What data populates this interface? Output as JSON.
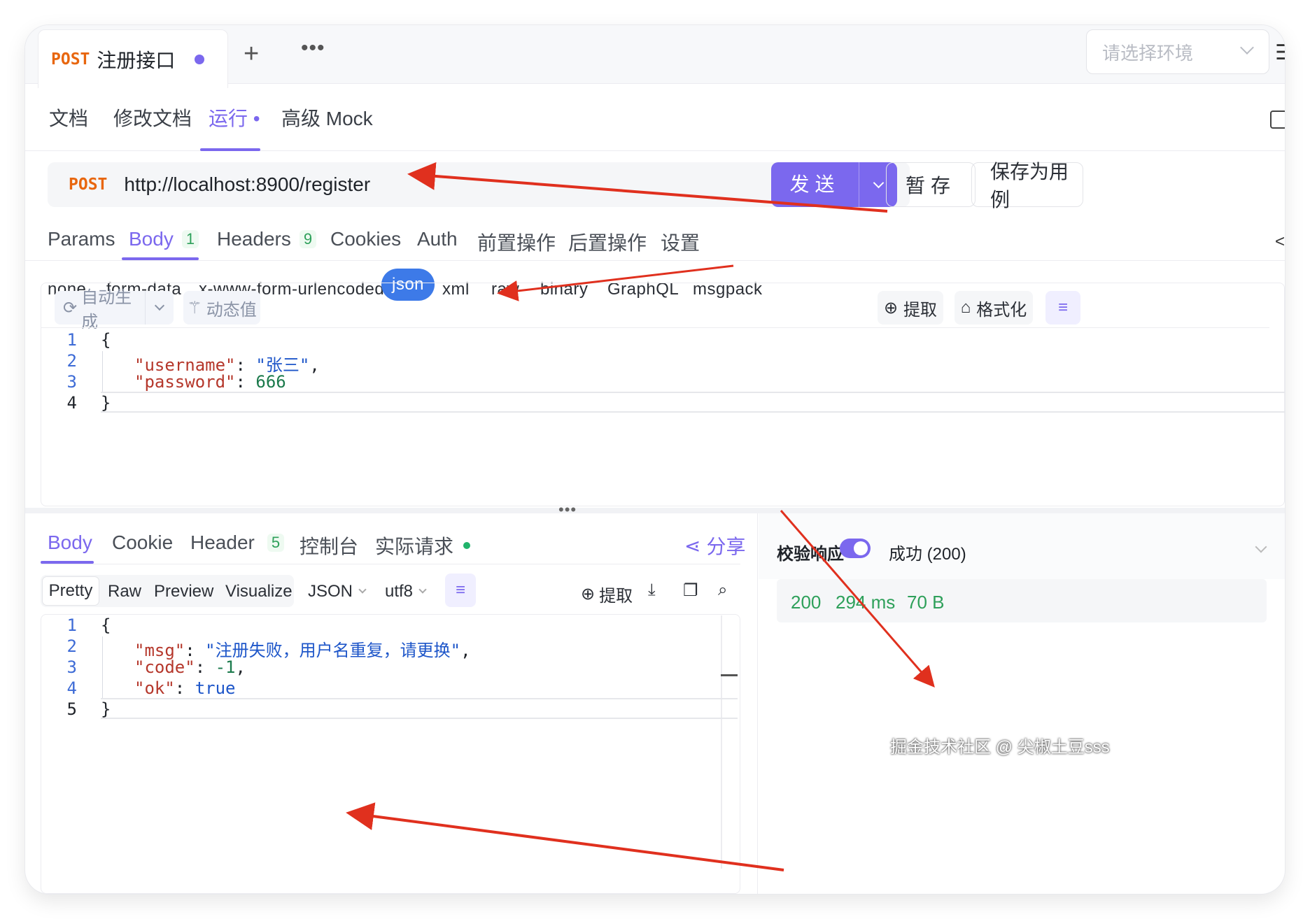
{
  "request_tab": {
    "method": "POST",
    "title": "注册接口"
  },
  "env_select": {
    "placeholder": "请选择环境"
  },
  "sub_tabs": [
    {
      "label": "文档"
    },
    {
      "label": "修改文档"
    },
    {
      "label": "运行 •"
    },
    {
      "label": "高级 Mock"
    }
  ],
  "url_bar": {
    "method": "POST",
    "url": "http://localhost:8900/register"
  },
  "actions": {
    "send": "发送",
    "stash": "暂存",
    "save_case": "保存为用例"
  },
  "request_tabs": [
    {
      "label": "Params"
    },
    {
      "label": "Body",
      "count": "1"
    },
    {
      "label": "Headers",
      "count": "9"
    },
    {
      "label": "Cookies"
    },
    {
      "label": "Auth"
    },
    {
      "label": "前置操作"
    },
    {
      "label": "后置操作"
    },
    {
      "label": "设置"
    }
  ],
  "body_types": [
    "none",
    "form-data",
    "x-www-form-urlencoded",
    "json",
    "xml",
    "raw",
    "binary",
    "GraphQL",
    "msgpack"
  ],
  "editor_toolbar": {
    "auto_generate": "自动生成",
    "dynamic_value": "动态值",
    "extract": "提取",
    "format": "格式化"
  },
  "request_body": {
    "line_numbers": [
      "1",
      "2",
      "3",
      "4"
    ],
    "open_brace": "{",
    "key1": "\"username\"",
    "val1": "\"张三\"",
    "key2": "\"password\"",
    "val2": "666",
    "close_brace": "}"
  },
  "response_tabs": [
    {
      "label": "Body"
    },
    {
      "label": "Cookie"
    },
    {
      "label": "Header",
      "count": "5"
    },
    {
      "label": "控制台"
    },
    {
      "label": "实际请求"
    }
  ],
  "share": "分享",
  "view_modes": [
    "Pretty",
    "Raw",
    "Preview",
    "Visualize"
  ],
  "format_select": "JSON",
  "encoding_select": "utf8",
  "response_extract": "提取",
  "response_body": {
    "line_numbers": [
      "1",
      "2",
      "3",
      "4",
      "5"
    ],
    "open_brace": "{",
    "key1": "\"msg\"",
    "val1": "\"注册失败，用户名重复，请更换\"",
    "key2": "\"code\"",
    "val2": "-1",
    "key3": "\"ok\"",
    "val3": "true",
    "close_brace": "}"
  },
  "validation": {
    "label": "校验响应",
    "enabled": true,
    "result": "成功 (200)"
  },
  "status": {
    "code": "200",
    "time": "294 ms",
    "size": "70 B"
  },
  "watermark": "掘金技术社区 @ 尖椒土豆sss",
  "colors": {
    "accent": "#7b68ee",
    "method": "#e8660e",
    "json_active": "#3d7ae8",
    "success": "#2ea05a",
    "annotation_arrow": "#e0301e"
  }
}
